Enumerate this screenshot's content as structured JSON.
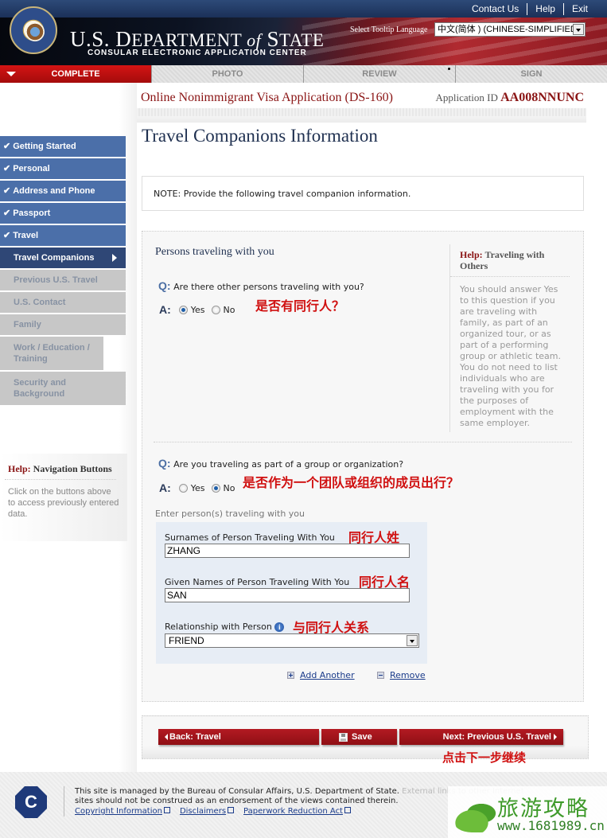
{
  "header": {
    "top_links": [
      "Contact Us",
      "Help",
      "Exit"
    ],
    "dept_title_prefix": "U.S. D",
    "dept_title_mid": "EPARTMENT ",
    "dept_title_of": "of",
    "dept_title_s": " S",
    "dept_title_end": "TATE",
    "subtitle": "CONSULAR ELECTRONIC APPLICATION CENTER",
    "tooltip_language_label": "Select Tooltip Language",
    "tooltip_language_value": "中文(简体 ) (CHINESE-SIMPLIFIED)"
  },
  "steps": [
    {
      "label": "COMPLETE",
      "active": true
    },
    {
      "label": "PHOTO",
      "active": false
    },
    {
      "label": "REVIEW",
      "active": false
    },
    {
      "label": "SIGN",
      "active": false
    }
  ],
  "application": {
    "title": "Online Nonimmigrant Visa Application (DS-160)",
    "id_label": "Application ID",
    "id_value": "AA008NNUNC"
  },
  "page_title": "Travel Companions Information",
  "sidebar": {
    "items": [
      {
        "label": "Getting Started",
        "status": "done"
      },
      {
        "label": "Personal",
        "status": "done"
      },
      {
        "label": "Address and Phone",
        "status": "done"
      },
      {
        "label": "Passport",
        "status": "done"
      },
      {
        "label": "Travel",
        "status": "done"
      },
      {
        "label": "Travel Companions",
        "status": "current"
      },
      {
        "label": "Previous U.S. Travel",
        "status": "todo"
      },
      {
        "label": "U.S. Contact",
        "status": "todo"
      },
      {
        "label": "Family",
        "status": "todo"
      },
      {
        "label": "Work / Education / Training",
        "status": "todo"
      },
      {
        "label": "Security and Background",
        "status": "todo"
      }
    ],
    "help_prefix": "Help:",
    "help_title": "Navigation Buttons",
    "help_text": "Click on the buttons above to access previously entered data."
  },
  "note": "NOTE: Provide the following travel companion information.",
  "section": {
    "title": "Persons traveling with you",
    "q_label": "Q:",
    "a_label": "A:",
    "q1": "Are there other persons traveling with you?",
    "q1_options": [
      "Yes",
      "No"
    ],
    "q1_selected": "Yes",
    "q1_annotation": "是否有同行人？",
    "q2": "Are you traveling as part of a group or organization?",
    "q2_options": [
      "Yes",
      "No"
    ],
    "q2_selected": "No",
    "q2_annotation": "是否作为一个团队或组织的成员出行？",
    "help_prefix": "Help:",
    "help_title": "Traveling with Others",
    "help_text": "You should answer Yes to this question if you are traveling with family, as part of an organized tour, or as part of a performing group or athletic team. You do not need to list individuals who are traveling with you for the purposes of employment with the same employer.",
    "enter_label": "Enter person(s) traveling with you",
    "surname_label": "Surnames of Person Traveling With You",
    "surname_value": "ZHANG",
    "surname_annotation": "同行人姓",
    "given_label": "Given Names of Person Traveling With You",
    "given_value": "SAN",
    "given_annotation": "同行人名",
    "relationship_label": "Relationship with Person",
    "relationship_value": "FRIEND",
    "relationship_annotation": "与同行人关系",
    "add_another": "Add Another",
    "remove": "Remove"
  },
  "buttons": {
    "back": "Back: Travel",
    "save": "Save",
    "next": "Next: Previous U.S. Travel",
    "next_annotation": "点击下一步继续"
  },
  "footer": {
    "text1": "This site is managed by the Bureau of Consular Affairs, U.S. Department of State.",
    "text_ext": "External links to other Internet",
    "text2": "sites should not be construed as an endorsement of the views contained therein.",
    "links": [
      "Copyright Information",
      "Disclaimers",
      "Paperwork Reduction Act"
    ],
    "logo_letter": "C"
  },
  "watermark": {
    "cn": "旅游攻略",
    "url": "www.1681989.cn"
  },
  "colors": {
    "accent_red": "#a40b0b",
    "nav_done": "#4b6fa9",
    "nav_current": "#2f4776",
    "annotation_red": "#d01010"
  }
}
